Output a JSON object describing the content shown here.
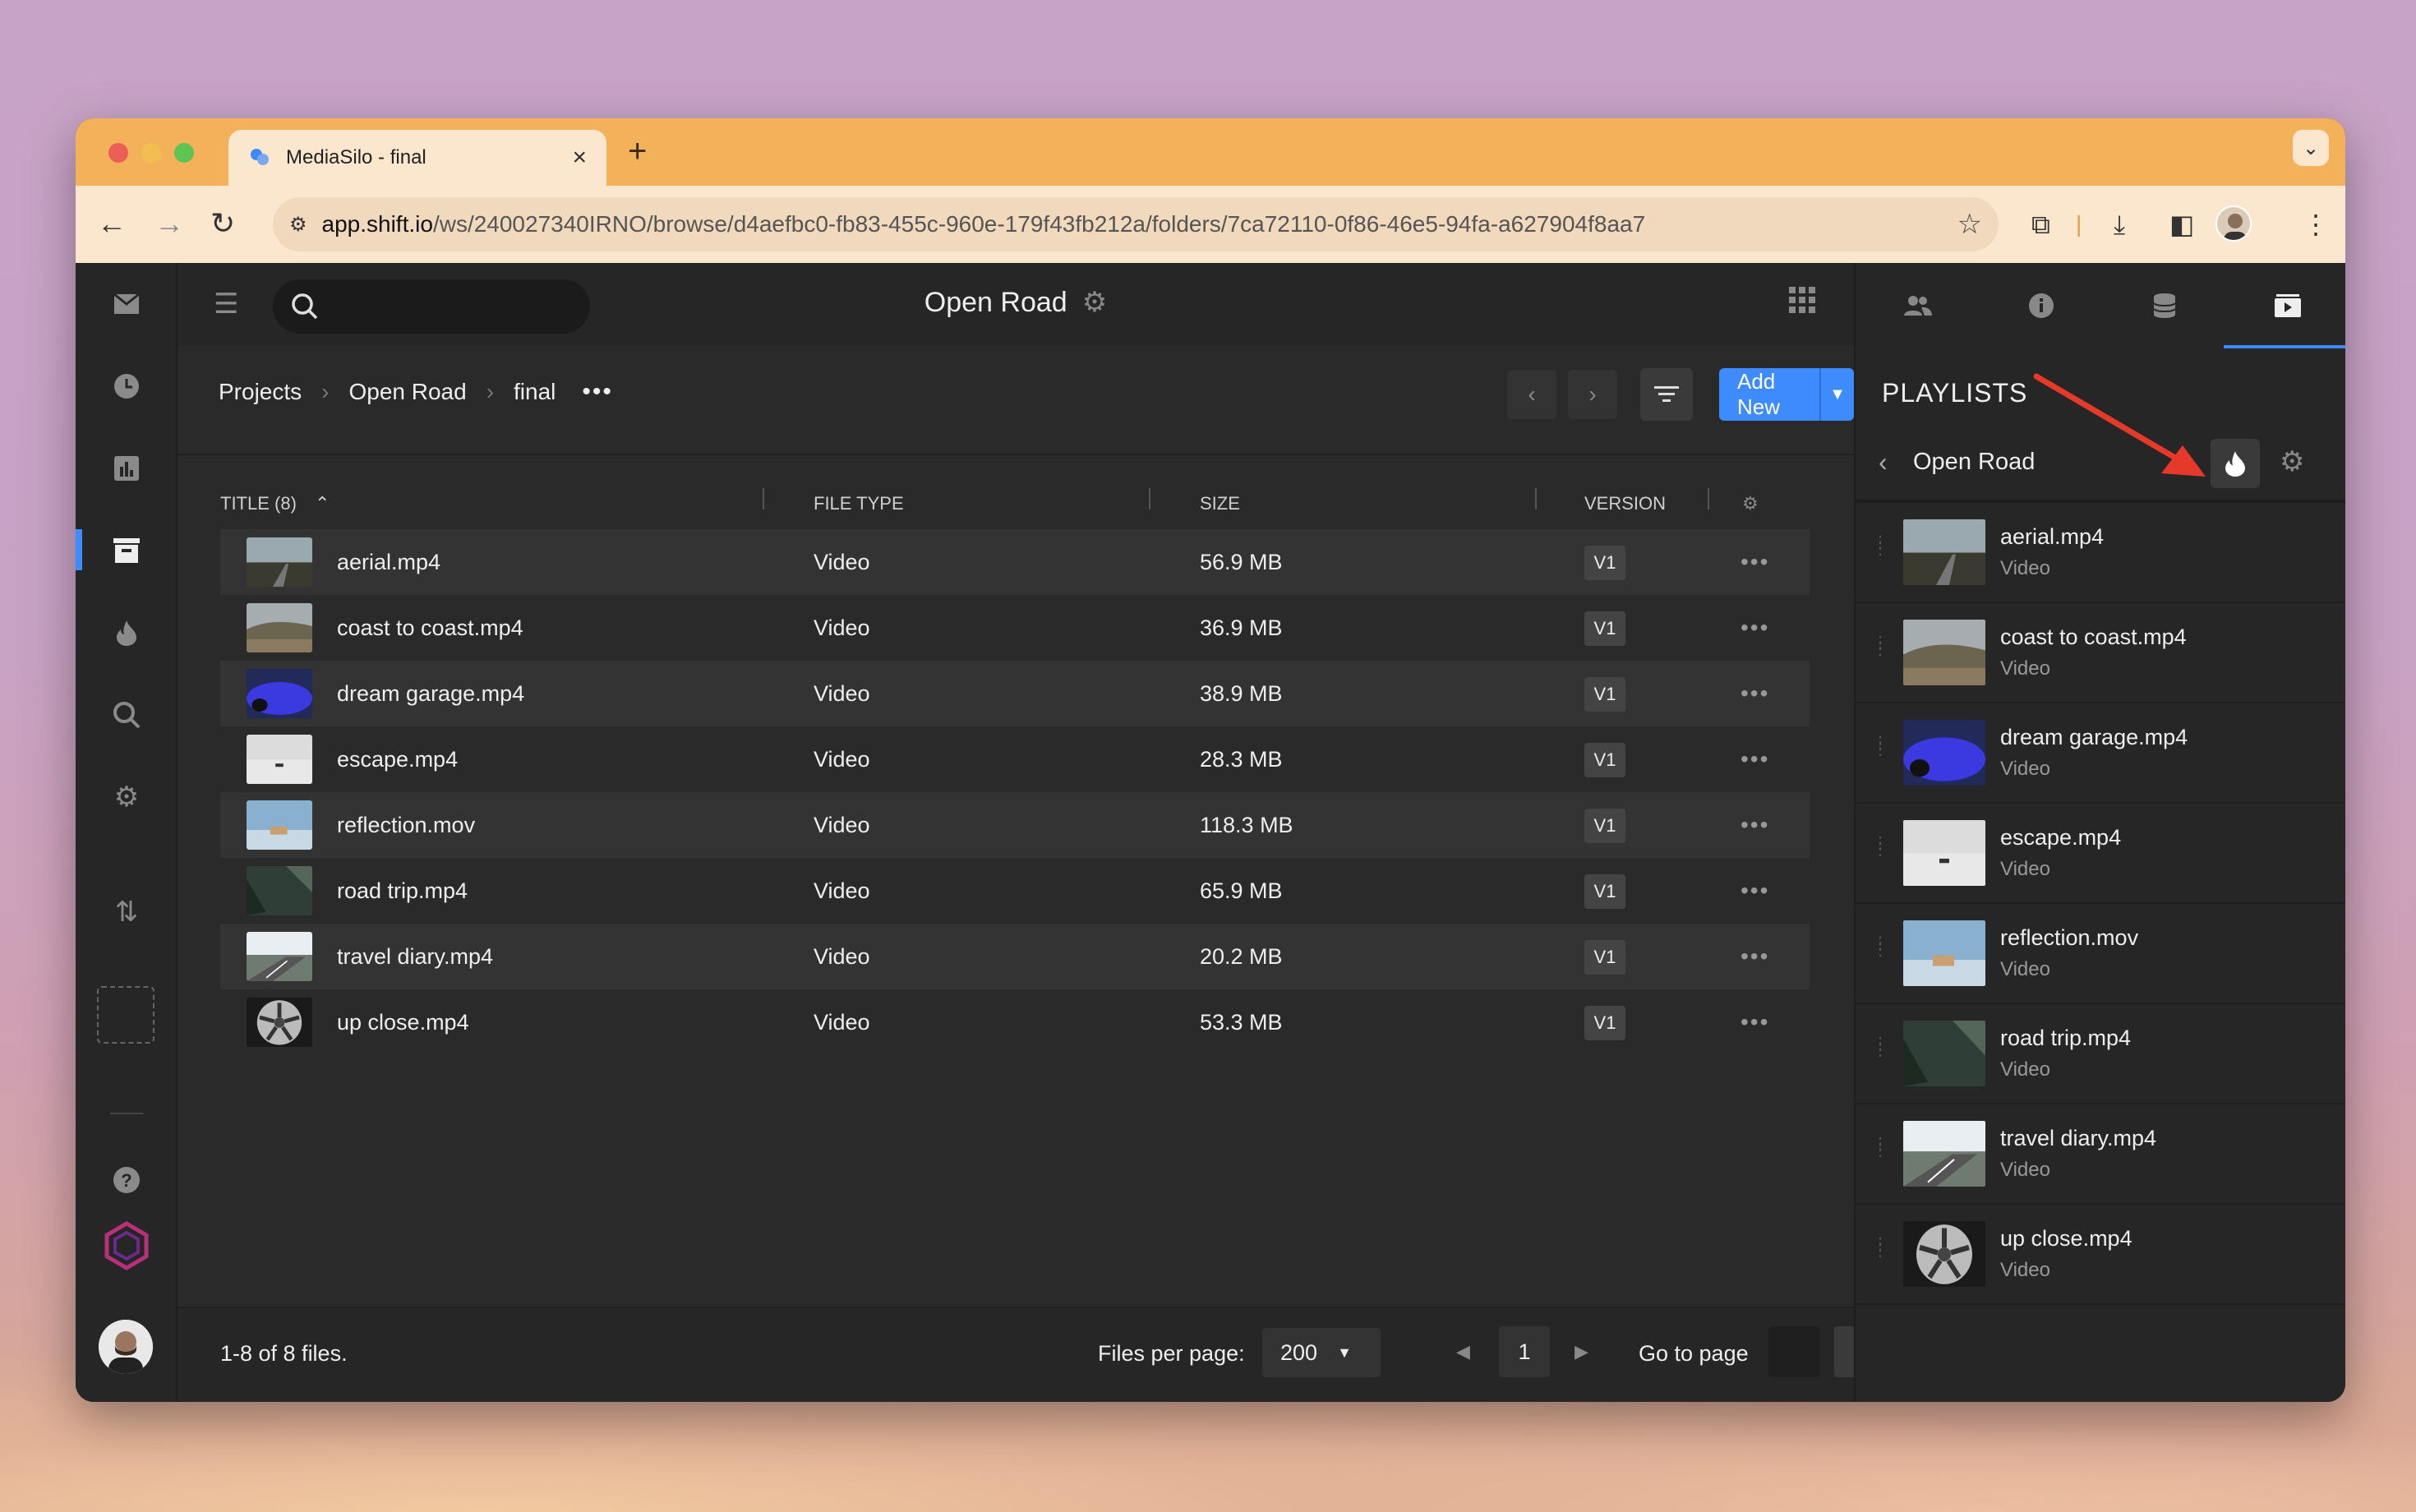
{
  "browser": {
    "tab_title": "MediaSilo - final",
    "tab_close": "×",
    "new_tab": "+",
    "url_host": "app.shift.io",
    "url_path": "/ws/240027340IRNO/browse/d4aefbc0-fb83-455c-960e-179f43fb212a/folders/7ca72110-0f86-46e5-94fa-a627904f8aa7"
  },
  "header": {
    "title": "Open Road"
  },
  "breadcrumb": [
    "Projects",
    "Open Road",
    "final"
  ],
  "toolbar": {
    "add_new_label": "Add New"
  },
  "table": {
    "columns": {
      "title": "TITLE (8)",
      "file_type": "FILE TYPE",
      "size": "SIZE",
      "version": "VERSION"
    },
    "rows": [
      {
        "name": "aerial.mp4",
        "type": "Video",
        "size": "56.9 MB",
        "version": "V1"
      },
      {
        "name": "coast to coast.mp4",
        "type": "Video",
        "size": "36.9 MB",
        "version": "V1"
      },
      {
        "name": "dream garage.mp4",
        "type": "Video",
        "size": "38.9 MB",
        "version": "V1"
      },
      {
        "name": "escape.mp4",
        "type": "Video",
        "size": "28.3 MB",
        "version": "V1"
      },
      {
        "name": "reflection.mov",
        "type": "Video",
        "size": "118.3 MB",
        "version": "V1"
      },
      {
        "name": "road trip.mp4",
        "type": "Video",
        "size": "65.9 MB",
        "version": "V1"
      },
      {
        "name": "travel diary.mp4",
        "type": "Video",
        "size": "20.2 MB",
        "version": "V1"
      },
      {
        "name": "up close.mp4",
        "type": "Video",
        "size": "53.3 MB",
        "version": "V1"
      }
    ]
  },
  "footer": {
    "count": "1-8 of 8 files.",
    "files_per_page_label": "Files per page:",
    "files_per_page": "200",
    "page": "1",
    "go_to_page": "Go to page"
  },
  "right_panel": {
    "section_title": "PLAYLISTS",
    "playlist_name": "Open Road",
    "items": [
      {
        "name": "aerial.mp4",
        "type": "Video"
      },
      {
        "name": "coast to coast.mp4",
        "type": "Video"
      },
      {
        "name": "dream garage.mp4",
        "type": "Video"
      },
      {
        "name": "escape.mp4",
        "type": "Video"
      },
      {
        "name": "reflection.mov",
        "type": "Video"
      },
      {
        "name": "road trip.mp4",
        "type": "Video"
      },
      {
        "name": "travel diary.mp4",
        "type": "Video"
      },
      {
        "name": "up close.mp4",
        "type": "Video"
      }
    ]
  },
  "colors": {
    "accent": "#3d8bfd",
    "annotation_arrow": "#e53a2a",
    "tab_bar": "#f3b15a"
  }
}
